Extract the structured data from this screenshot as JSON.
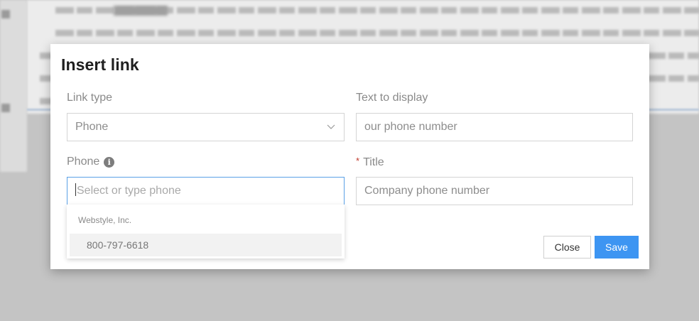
{
  "dialog": {
    "title": "Insert link",
    "link_type": {
      "label": "Link type",
      "value": "Phone"
    },
    "text_to_display": {
      "label": "Text to display",
      "value": "our phone number"
    },
    "phone": {
      "label": "Phone",
      "placeholder": "Select or type phone",
      "dropdown": {
        "group_label": "Webstyle, Inc.",
        "options": [
          "800-797-6618"
        ]
      }
    },
    "title_field": {
      "label": "Title",
      "required_mark": "*",
      "value": "Company phone number"
    },
    "buttons": {
      "close": "Close",
      "save": "Save"
    }
  },
  "colors": {
    "accent": "#3d95f2",
    "focus_border": "#5aa0e6",
    "required": "#c0392b"
  },
  "icons": {
    "info": "info-icon",
    "chevron": "chevron-down-icon"
  }
}
